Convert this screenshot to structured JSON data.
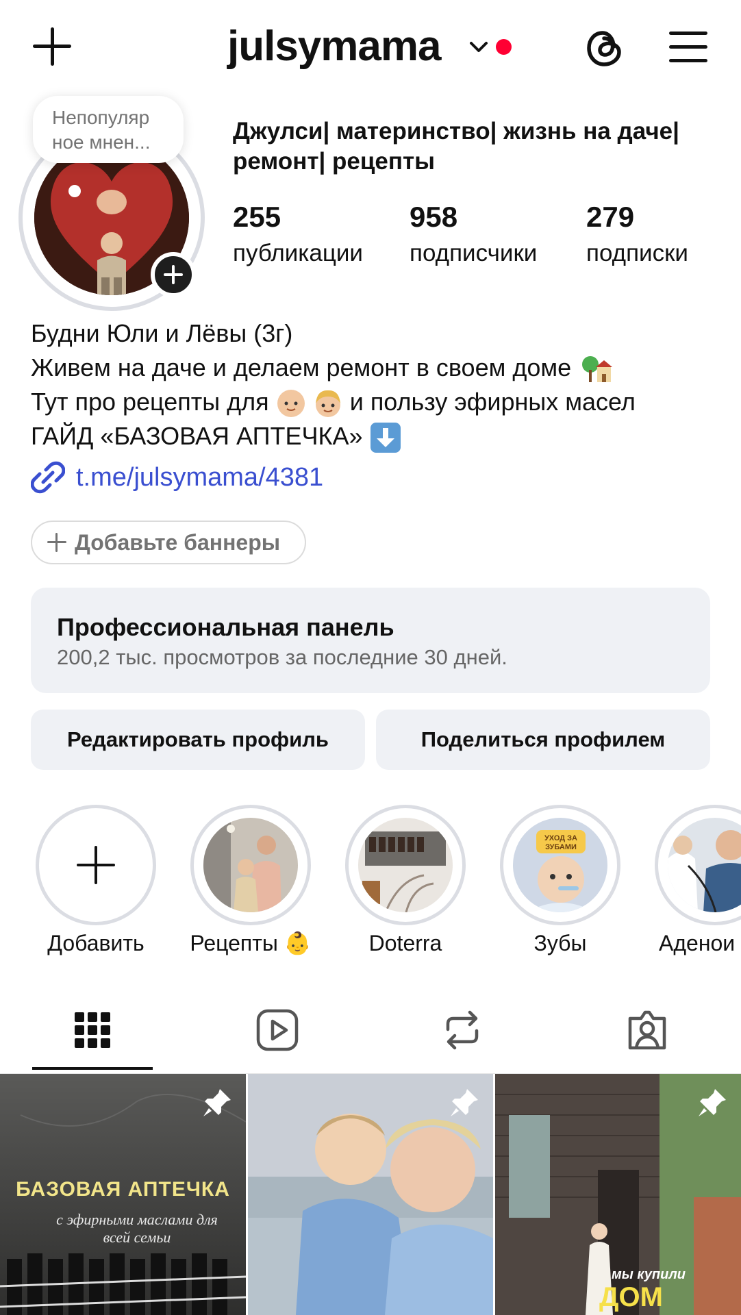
{
  "header": {
    "username": "julsymama",
    "icons": [
      "plus-icon",
      "chevron-down-icon",
      "notification-dot",
      "threads-icon",
      "menu-icon"
    ],
    "accent_color": "#ff0033"
  },
  "profile": {
    "note": "Непопуляр\nное мнен...",
    "full_name": "Джулси| материнство| жизнь на даче| ремонт| рецепты",
    "stats": [
      {
        "count": "255",
        "label": "публикации"
      },
      {
        "count": "958",
        "label": "подписчики"
      },
      {
        "count": "279",
        "label": "подписки"
      }
    ],
    "bio": {
      "line1": "Будни Юли и Лёвы (3г)",
      "line2": "Живем на даче и делаем ремонт в своем доме",
      "line3_a": "Тут про рецепты для",
      "line3_b": "и пользу эфирных масел",
      "line4": "ГАЙД «БАЗОВАЯ АПТЕЧКА»"
    },
    "link": "t.me/julsymama/4381",
    "link_color": "#3a4fd0",
    "banner_button": "Добавьте баннеры"
  },
  "pro_panel": {
    "title": "Профессиональная панель",
    "subtitle": "200,2 тыс. просмотров за последние 30 дней."
  },
  "actions": {
    "edit": "Редактировать профиль",
    "share": "Поделиться профилем"
  },
  "highlights": [
    {
      "label": "Добавить"
    },
    {
      "label": "Рецепты 👶"
    },
    {
      "label": "Doterra"
    },
    {
      "label": "Зубы",
      "badge": "УХОД ЗА ЗУБАМИ"
    },
    {
      "label": "Аденои"
    }
  ],
  "tabs": [
    "grid-icon",
    "reels-icon",
    "reposts-icon",
    "tagged-icon"
  ],
  "posts": [
    {
      "title": "БАЗОВАЯ АПТЕЧКА",
      "subtitle": "с эфирными маслами для всей семьи",
      "pinned": true
    },
    {
      "pinned": true
    },
    {
      "caption_small": "мы купили",
      "caption_big": "ДОМ",
      "pinned": true
    }
  ]
}
